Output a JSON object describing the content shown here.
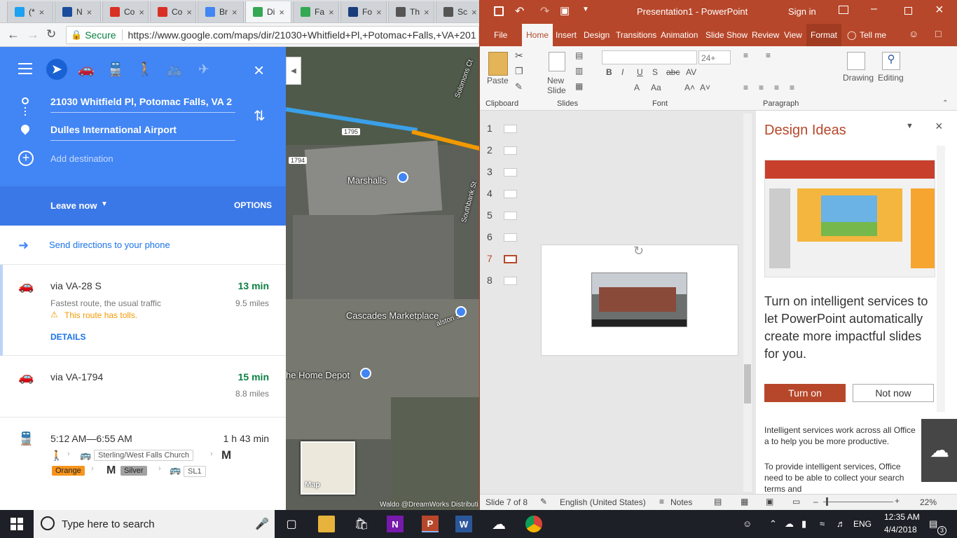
{
  "chrome": {
    "tabs": [
      {
        "label": "(*",
        "color": "#1da1f2"
      },
      {
        "label": "N",
        "color": "#1a4d9b"
      },
      {
        "label": "Co",
        "color": "#d93025"
      },
      {
        "label": "Co",
        "color": "#d93025"
      },
      {
        "label": "Br",
        "color": "#4285f4"
      },
      {
        "label": "Di",
        "color": "#34a853"
      },
      {
        "label": "Fa",
        "color": "#34a853"
      },
      {
        "label": "Fo",
        "color": "#1a3e7a"
      },
      {
        "label": "Th",
        "color": "#555555"
      },
      {
        "label": "Sc",
        "color": "#555555"
      }
    ],
    "secure_label": "Secure",
    "url": "https://www.google.com/maps/dir/21030+Whitfield+Pl,+Potomac+Falls,+VA+201"
  },
  "maps": {
    "origin": "21030 Whitfield Pl, Potomac Falls, VA 2",
    "destination": "Dulles International Airport",
    "add_destination": "Add destination",
    "leave_now": "Leave now",
    "options": "OPTIONS",
    "send_directions": "Send directions to your phone",
    "routes": [
      {
        "name": "via VA-28 S",
        "time": "13 min",
        "desc": "Fastest route, the usual traffic",
        "distance": "9.5 miles",
        "warning": "This route has tolls.",
        "details": "DETAILS"
      },
      {
        "name": "via VA-1794",
        "time": "15 min",
        "distance": "8.8 miles"
      }
    ],
    "transit": {
      "times": "5:12 AM—6:55 AM",
      "duration": "1 h 43 min",
      "stop": "Sterling/West Falls Church",
      "metro": "M",
      "lines": [
        "Orange",
        "Silver"
      ],
      "bus": "SL1"
    },
    "map_labels": {
      "marshalls": "Marshalls",
      "cascades": "Cascades Marketplace",
      "home_depot": "he Home Depot",
      "road_1795": "1795",
      "road_1794": "1794",
      "solomons": "Solomons Ct",
      "southbank": "Southbank St",
      "ralston": "alston St",
      "map_toggle": "Map",
      "credit": "Waldo @DreamWorks Distributi"
    }
  },
  "ppt": {
    "title": "Presentation1 - PowerPoint",
    "sign_in": "Sign in",
    "tabs": [
      "File",
      "Home",
      "Insert",
      "Design",
      "Transitions",
      "Animation",
      "Slide Show",
      "Review",
      "View",
      "Format",
      "Tell me"
    ],
    "ribbon": {
      "paste": "Paste",
      "new_slide": "New Slide",
      "font_size": "24+",
      "drawing": "Drawing",
      "editing": "Editing",
      "groups": [
        "Clipboard",
        "Slides",
        "Font",
        "Paragraph"
      ]
    },
    "slide_numbers": [
      "1",
      "2",
      "3",
      "4",
      "5",
      "6",
      "7",
      "8"
    ],
    "design_ideas": {
      "title": "Design Ideas",
      "headline": "Turn on intelligent services to let PowerPoint automatically create more impactful slides for you.",
      "turn_on": "Turn on",
      "not_now": "Not now",
      "para1": "Intelligent services work across all Office a to help you be more productive.",
      "para2": "To provide intelligent services, Office need to be able to collect your search terms and"
    },
    "status": {
      "slide": "Slide 7 of 8",
      "language": "English (United States)",
      "notes": "Notes",
      "zoom": "22%"
    }
  },
  "taskbar": {
    "search_placeholder": "Type here to search",
    "language": "ENG",
    "time": "12:35 AM",
    "date": "4/4/2018",
    "notification_count": "3"
  },
  "colors": {
    "ppt_accent": "#b7472a",
    "maps_blue": "#4285f4",
    "route_green": "#0b8043",
    "warning_orange": "#f29900"
  }
}
